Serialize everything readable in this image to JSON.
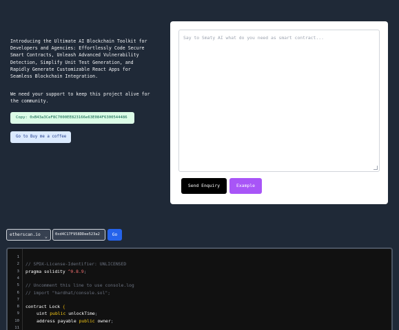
{
  "intro": {
    "lines": [
      "Introducing the Ultimate AI Blockchain Toolkit for",
      "Developers and Agencies: Effortlessly Code Secure",
      "Smart Contracts, Unleash Advanced Vulnerability",
      "Detection, Simplify Unit Test Generation, and",
      "Rapidly Generate Customizable React Apps for",
      "Seamless Blockchain Integration."
    ]
  },
  "support": {
    "lines": [
      "We need your support to keep this project alive for",
      "the community."
    ]
  },
  "copy_button": "Copy: 0xB43a3CeF8C7000EE823166e63E084F6300544486",
  "coffee_button": "Go to Buy me a coffee",
  "prompt": {
    "placeholder": "Say to Smaty AI what do you need as smart contract..."
  },
  "send_button": "Send Enquiry",
  "example_button": "Example",
  "explorer": {
    "selected": "etherscan.io",
    "address": "0xd4C17F958DDee523a2",
    "go_label": "Go"
  },
  "code": {
    "line_numbers": [
      "1",
      "2",
      "3",
      "4",
      "5",
      "6",
      "7",
      "8",
      "9",
      "10",
      "11"
    ],
    "line1": "",
    "line2": "// SPDX-License-Identifier: UNLICENSED",
    "line3_kw": "pragma solidity ",
    "line3_ver": "^0.8.9",
    "line3_end": ";",
    "line4": "",
    "line5": "// Uncomment this line to use console.log",
    "line6": "// import \"hardhat/console.sol\";",
    "line7": "",
    "line8_kw": "contract Lock ",
    "line8_brace": "{",
    "line9_a": "uint ",
    "line9_pub": "public",
    "line9_b": " unlockTime",
    "line9_end": ";",
    "line10_a": "address payable ",
    "line10_pub": "public",
    "line10_b": " owner",
    "line10_end": ";"
  },
  "colors": {
    "background": "#1f2937",
    "copy_bg": "#dcfce7",
    "coffee_bg": "#dbeafe",
    "send_bg": "#000000",
    "example_bg": "#a855f7",
    "go_bg": "#2563eb"
  }
}
